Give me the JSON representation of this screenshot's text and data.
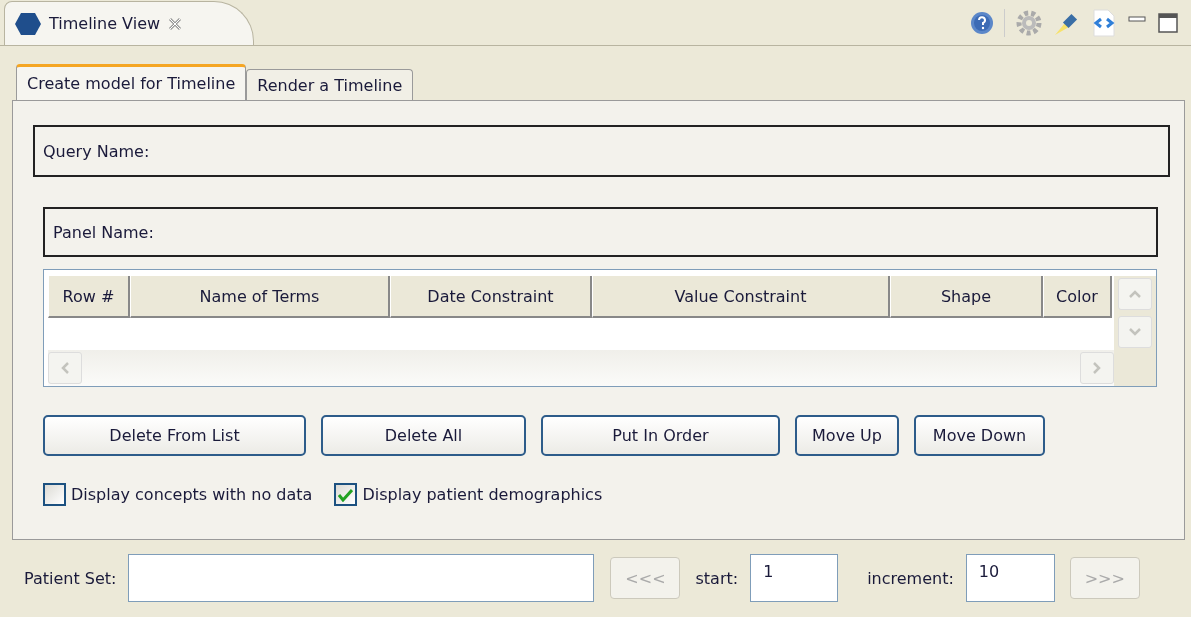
{
  "view": {
    "title": "Timeline View"
  },
  "tabs": [
    {
      "label": "Create model for Timeline",
      "selected": true
    },
    {
      "label": "Render a Timeline",
      "selected": false
    }
  ],
  "query_name": {
    "label": "Query Name:"
  },
  "panel_name": {
    "label": "Panel Name:"
  },
  "table": {
    "columns": [
      "Row #",
      "Name of Terms",
      "Date Constraint",
      "Value Constraint",
      "Shape",
      "Color"
    ]
  },
  "buttons": [
    {
      "label": "Delete From List"
    },
    {
      "label": "Delete All"
    },
    {
      "label": "Put In Order"
    },
    {
      "label": "Move Up"
    },
    {
      "label": "Move Down"
    }
  ],
  "options": [
    {
      "label": "Display concepts with no data",
      "checked": false
    },
    {
      "label": "Display patient demographics",
      "checked": true
    }
  ],
  "patient_set": {
    "label": "Patient Set:"
  },
  "prev_button": {
    "label": "<<<",
    "disabled": true
  },
  "start": {
    "label": "start:",
    "value": "1"
  },
  "increment": {
    "label": "increment:",
    "value": "10"
  },
  "next_button": {
    "label": ">>>",
    "disabled": true
  }
}
